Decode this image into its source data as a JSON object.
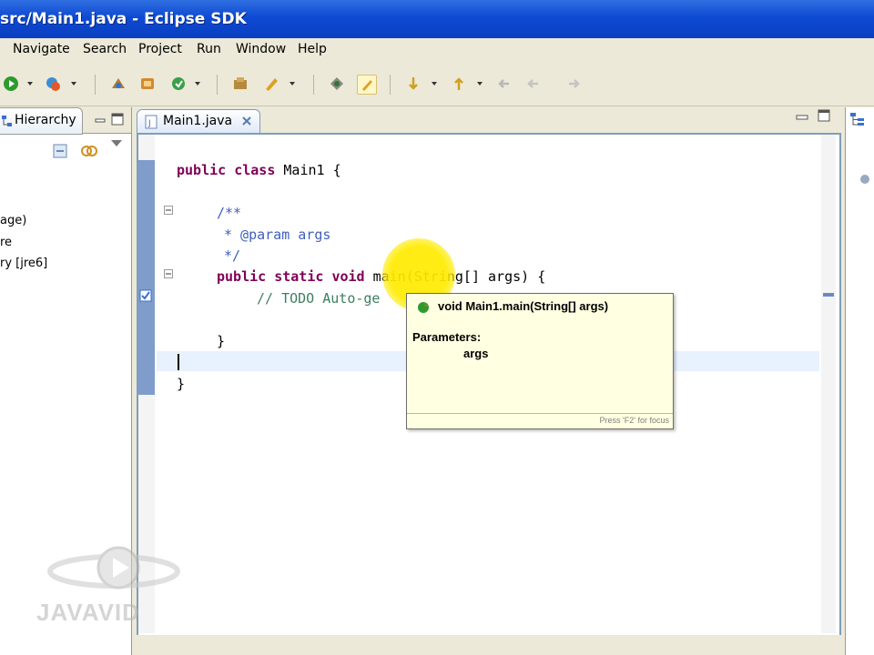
{
  "window": {
    "title": "src/Main1.java - Eclipse SDK"
  },
  "menu": {
    "items": [
      "Navigate",
      "Search",
      "Project",
      "Run",
      "Window",
      "Help"
    ]
  },
  "toolbar": {
    "icons": [
      "run-icon",
      "debug-icon",
      "new-java-package-icon",
      "new-java-class-icon",
      "search-icon",
      "open-type-icon",
      "toggle-mark-occurrences-icon",
      "next-annotation-icon",
      "previous-annotation-icon",
      "back-icon",
      "forward-icon"
    ]
  },
  "left_panel": {
    "tab_label": "Hierarchy",
    "tree_items": [
      "age)",
      "re",
      "ry [jre6]"
    ]
  },
  "editor": {
    "tab_label": "Main1.java",
    "code": {
      "kw_public": "public",
      "kw_class": "class",
      "class_name": "Main1 {",
      "javadoc_open": "/**",
      "javadoc_param": "* @param args",
      "javadoc_close": "*/",
      "kw_static": "static",
      "kw_void": "void",
      "method_name": "main",
      "params": "(String[] args) {",
      "todo_comment": "// TODO Auto-ge",
      "close_method": "}",
      "close_class": "}"
    }
  },
  "hover": {
    "signature": "void Main1.main(String[] args)",
    "parameters_label": "Parameters:",
    "param_name": "args",
    "hint": "Press 'F2' for focus"
  },
  "watermark": {
    "text": "JAVAVID"
  },
  "colors": {
    "title_bar": "#0d4ad3",
    "keyword": "#7f0055",
    "javadoc": "#3f5fbf",
    "comment": "#3f7f5f",
    "hover_bg": "#ffffe1",
    "cursor_highlight": "#ffeb00"
  }
}
